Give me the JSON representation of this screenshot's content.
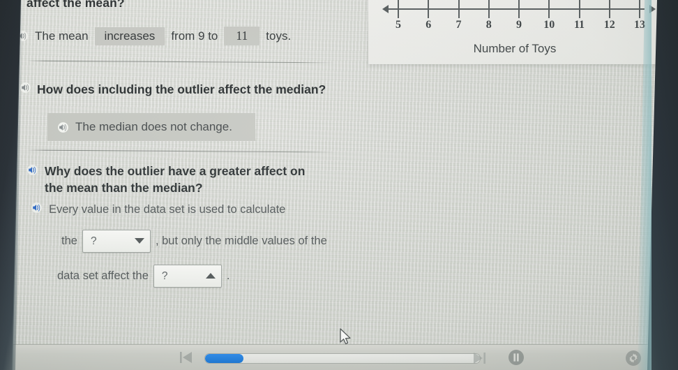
{
  "question1": {
    "prompt_tail": "affect the mean?",
    "speaker_icon": "speaker-icon",
    "sentence_prefix": "The mean",
    "answer_trend": "increases",
    "sentence_middle": "from 9 to",
    "answer_value": "11",
    "sentence_suffix": "toys."
  },
  "question2": {
    "speaker_icon": "speaker-icon",
    "prompt": "How does including the outlier affect the median?",
    "answer": {
      "speaker_icon": "speaker-icon",
      "text": "The median does not change."
    }
  },
  "question3": {
    "speaker_icon": "speaker-icon",
    "prompt_line1": "Why does the outlier have a greater affect on",
    "prompt_line2": "the mean than the median?",
    "answer_speaker_icon": "speaker-icon",
    "answer_line1": "Every value in the data set is used to calculate",
    "answer_line2_prefix": "the",
    "dropdown1": {
      "value": "?",
      "state": "closed",
      "chevron": "chevron-down-icon"
    },
    "answer_line2_suffix": ", but only the middle values of the",
    "answer_line3_prefix": "data set affect the",
    "dropdown2": {
      "value": "?",
      "state": "open",
      "chevron": "chevron-up-icon"
    },
    "answer_line3_suffix": "."
  },
  "chart_data": {
    "type": "line",
    "title": "",
    "xlabel": "Number of Toys",
    "ylabel": "",
    "x": [
      5,
      6,
      7,
      8,
      9,
      10,
      11,
      12,
      13
    ],
    "tick_labels": [
      "5",
      "6",
      "7",
      "8",
      "9",
      "10",
      "11",
      "12",
      "13"
    ],
    "xlim": [
      5,
      13
    ],
    "grid": false,
    "legend": "none",
    "axis_arrows_both_ends": true,
    "note": "Horizontal number line axis labeled 5 through 13; the plotted dot-plot marks above the line are cropped off the top of the screenshot."
  },
  "player": {
    "prev_icon": "skip-previous-icon",
    "next_icon": "skip-next-icon",
    "pause_icon": "pause-icon",
    "settings_icon": "gear-icon",
    "progress_percent": 14,
    "progress_label": ""
  },
  "cursor": {
    "icon": "mouse-pointer-icon"
  },
  "colors": {
    "accent_blue": "#0a6fd8",
    "speaker_blue": "#1f5fc4",
    "speaker_gray": "#f3f4f0",
    "highlight_gray": "#c6c7c2",
    "screen_bg": "#d5d6d1",
    "panel_bg": "#f2f2ef",
    "text_dark": "#1d2224",
    "axis": "#4d5355"
  }
}
